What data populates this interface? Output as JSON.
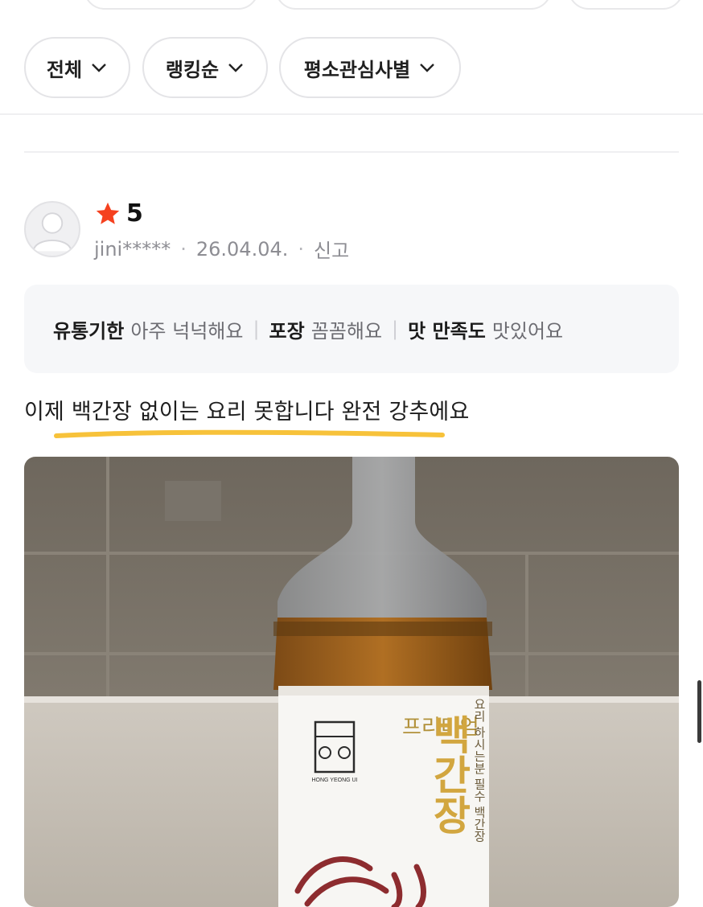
{
  "filters": [
    {
      "label": "전체"
    },
    {
      "label": "랭킹순"
    },
    {
      "label": "평소관심사별"
    }
  ],
  "review": {
    "rating": "5",
    "user": "jini*****",
    "date": "26.04.04.",
    "report_label": "신고",
    "summary": [
      {
        "key": "유통기한",
        "value": "아주 넉넉해요"
      },
      {
        "key": "포장",
        "value": "꼼꼼해요"
      },
      {
        "key": "맛 만족도",
        "value": "맛있어요"
      }
    ],
    "text": "이제 백간장 없이는 요리 못합니다 완전 강추에요",
    "photo": {
      "label_small": "프리미엄",
      "label_big": "백간장",
      "vertical_text": "요리 하시는분 필수 백간장",
      "brand": "HONG YEONG UI"
    }
  },
  "colors": {
    "star": "#f5411f",
    "highlight": "#f7c23a",
    "summary_bg": "#f6f7f9"
  },
  "icons": [
    "chevron-down-icon",
    "star-icon",
    "avatar-icon"
  ]
}
